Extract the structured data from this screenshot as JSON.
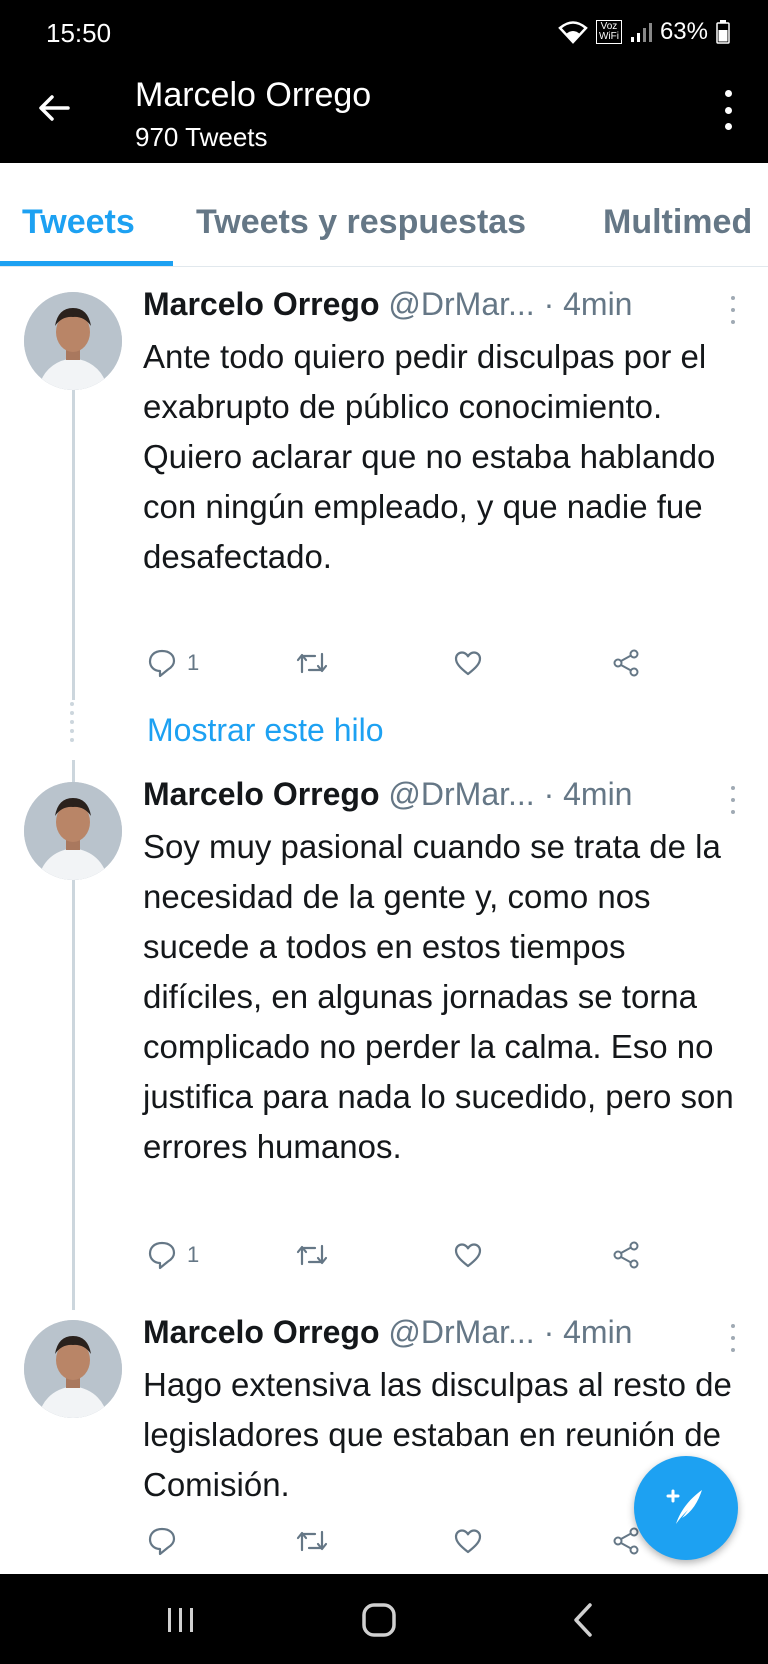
{
  "status_bar": {
    "time": "15:50",
    "wifi_label": "Voz WiFi",
    "battery": "63%"
  },
  "header": {
    "title": "Marcelo Orrego",
    "subtitle": "970 Tweets"
  },
  "tabs": [
    {
      "label": "Tweets",
      "active": true
    },
    {
      "label": "Tweets y respuestas",
      "active": false
    },
    {
      "label": "Multimed",
      "active": false
    }
  ],
  "tweets": [
    {
      "name": "Marcelo Orrego",
      "handle": "@DrMar...",
      "time": "· 4min",
      "text": "Ante todo quiero pedir disculpas por el exabrupto de público conocimiento. Quiero aclarar que no estaba hablando con ningún empleado, y que nadie fue desafectado.",
      "reply_count": "1"
    },
    {
      "name": "Marcelo Orrego",
      "handle": "@DrMar...",
      "time": "· 4min",
      "text": "Soy muy pasional cuando se trata de la necesidad de la gente y, como nos sucede a todos en estos tiempos difíciles, en algunas jornadas se torna complicado no perder la calma. Eso no justifica para nada lo sucedido, pero son errores humanos.",
      "reply_count": "1"
    },
    {
      "name": "Marcelo Orrego",
      "handle": "@DrMar...",
      "time": "· 4min",
      "text": "Hago extensiva las disculpas al resto de legisladores que estaban en reunión de Comisión.",
      "reply_count": ""
    }
  ],
  "show_thread": "Mostrar este hilo",
  "colors": {
    "accent": "#1da1f2",
    "muted": "#657786",
    "text": "#14171a"
  },
  "icons": {
    "back": "arrow-left-icon",
    "overflow": "more-vertical-icon",
    "reply": "comment-icon",
    "retweet": "retweet-icon",
    "like": "heart-icon",
    "share": "share-icon",
    "compose": "compose-tweet-icon"
  }
}
